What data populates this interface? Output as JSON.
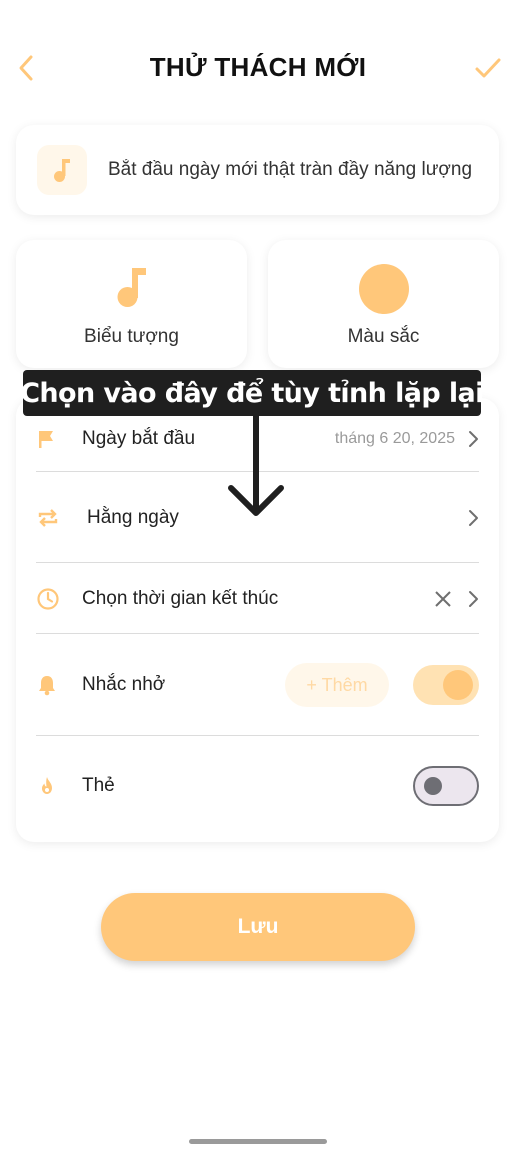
{
  "header": {
    "title": "THỬ THÁCH MỚI"
  },
  "name": {
    "text": "Bắt đầu ngày mới thật tràn đầy năng lượng"
  },
  "icon_card": {
    "label": "Biểu tượng",
    "icon": "music-note-icon"
  },
  "color_card": {
    "label": "Màu sắc",
    "color": "#ffc77a"
  },
  "settings": {
    "start_date": {
      "label": "Ngày bắt đầu",
      "value": "tháng 6 20, 2025"
    },
    "repeat": {
      "label": "Hằng ngày"
    },
    "end_time": {
      "label": "Chọn thời gian kết thúc"
    },
    "reminder": {
      "label": "Nhắc nhở",
      "add_label": "+ Thêm",
      "enabled": true
    },
    "tag": {
      "label": "Thẻ",
      "enabled": false
    }
  },
  "annotation": {
    "text": "Chọn vào đây để tùy tỉnh lặp lại"
  },
  "save_button": {
    "label": "Lưu"
  },
  "colors": {
    "accent": "#ffc77a",
    "accent_light": "#fff7ea"
  }
}
